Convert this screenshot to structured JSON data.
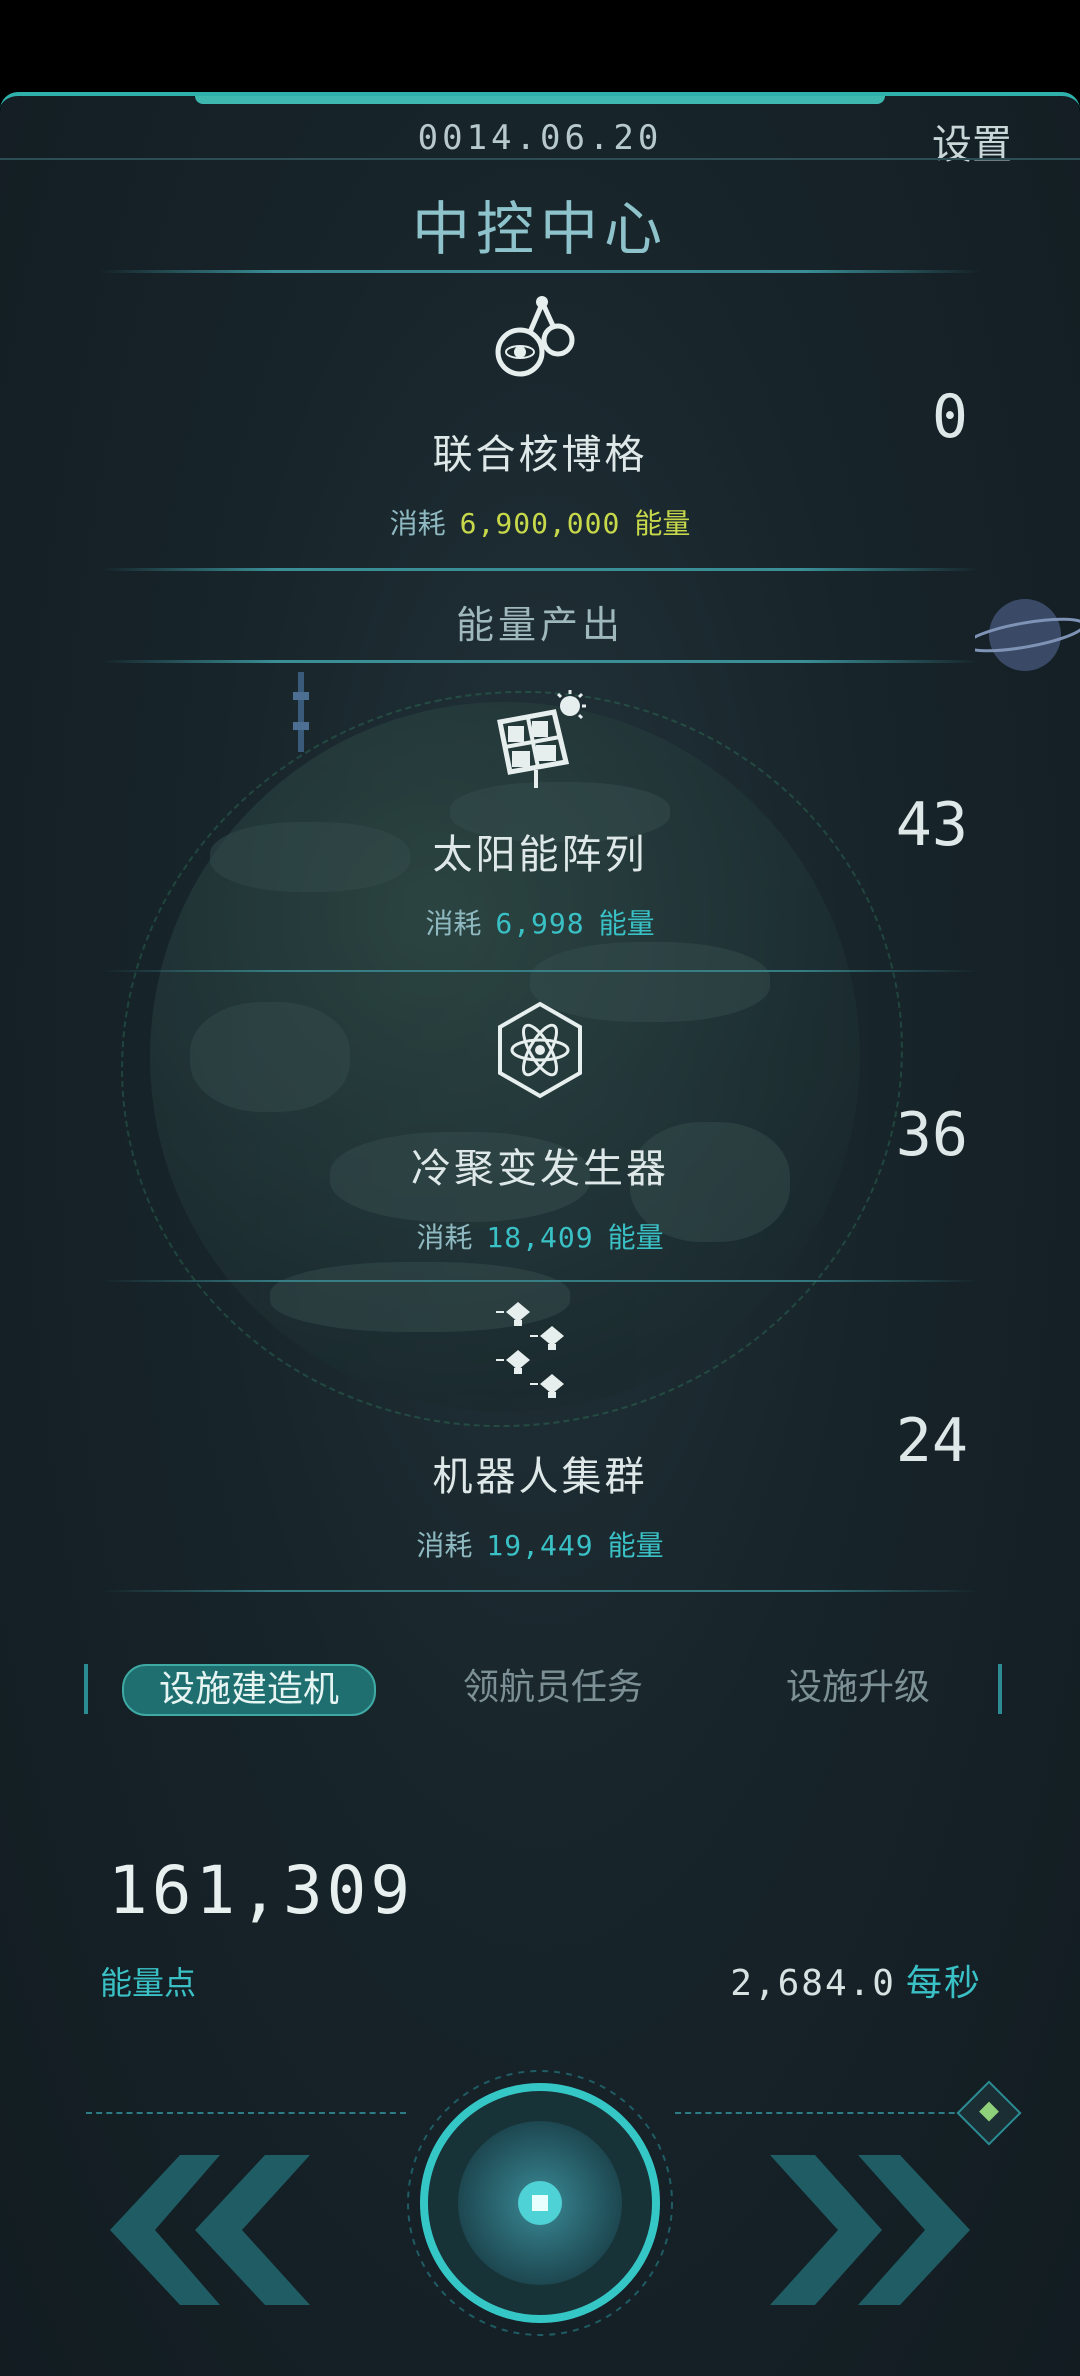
{
  "header": {
    "date": "0014.06.20",
    "settings_label": "设置",
    "title": "中控中心"
  },
  "featured": {
    "icon": "molecule-icon",
    "name": "联合核博格",
    "cost_label": "消耗",
    "cost_value": "6,900,000",
    "cost_unit": "能量",
    "count": "0",
    "cost_color": "#c7d94a"
  },
  "section_label": "能量产出",
  "buildings": [
    {
      "icon": "solar-panel-icon",
      "name": "太阳能阵列",
      "cost_label": "消耗",
      "cost_value": "6,998",
      "cost_unit": "能量",
      "count": "43"
    },
    {
      "icon": "atom-hexagon-icon",
      "name": "冷聚变发生器",
      "cost_label": "消耗",
      "cost_value": "18,409",
      "cost_unit": "能量",
      "count": "36"
    },
    {
      "icon": "robot-swarm-icon",
      "name": "机器人集群",
      "cost_label": "消耗",
      "cost_value": "19,449",
      "cost_unit": "能量",
      "count": "24"
    }
  ],
  "tabs": [
    {
      "label": "设施建造机",
      "active": true
    },
    {
      "label": "领航员任务",
      "active": false
    },
    {
      "label": "设施升级",
      "active": false
    }
  ],
  "energy": {
    "value": "161,309",
    "label": "能量点",
    "rate": "2,684.0",
    "rate_unit": "每秒"
  },
  "controls": {
    "prev_icon": "double-chevron-left-icon",
    "next_icon": "double-chevron-right-icon",
    "main_icon": "tap-button-icon"
  },
  "colors": {
    "accent": "#39c1c6",
    "cost_cyan": "#39c1c6",
    "frame": "#2fb0aa"
  }
}
